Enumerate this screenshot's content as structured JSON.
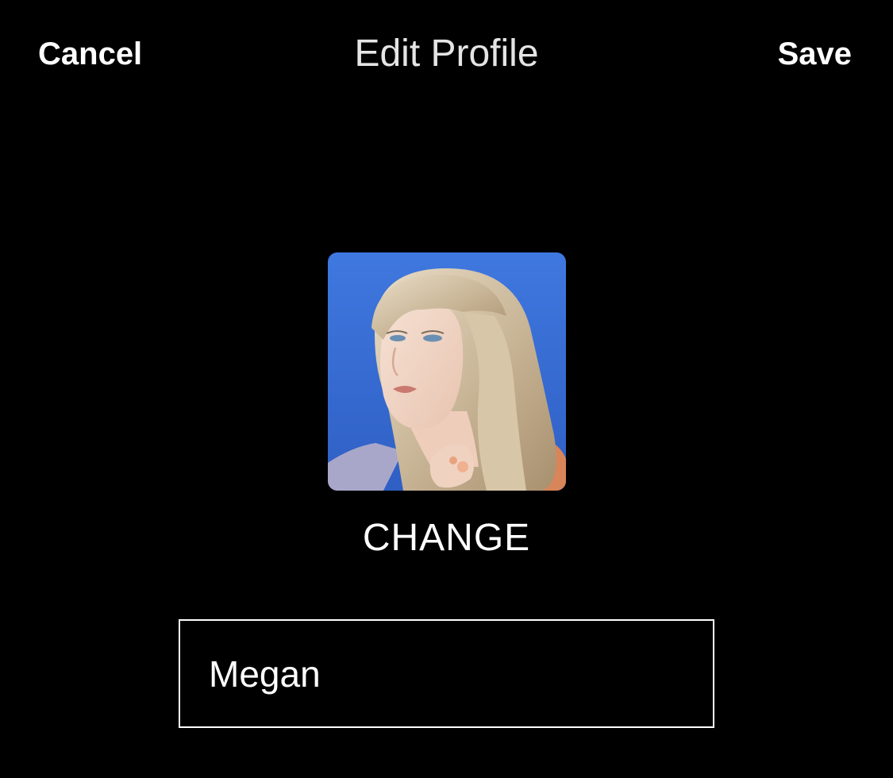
{
  "header": {
    "cancel_label": "Cancel",
    "title": "Edit Profile",
    "save_label": "Save"
  },
  "profile": {
    "avatar_icon": "profile-photo-icon",
    "change_label": "CHANGE",
    "name_value": "Megan"
  },
  "colors": {
    "background": "#000000",
    "text": "#ffffff",
    "title_text": "#e5e5e5",
    "avatar_background": "#3a6fd8"
  }
}
